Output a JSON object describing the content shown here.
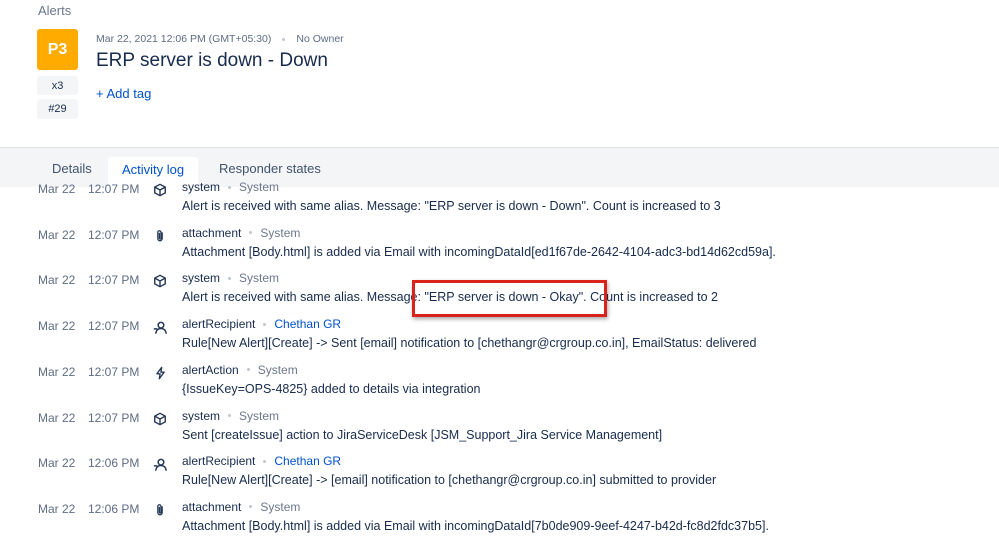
{
  "breadcrumb": "Alerts",
  "alert": {
    "priority": "P3",
    "count": "x3",
    "tiny_id": "#29",
    "timestamp": "Mar 22, 2021 12:06 PM (GMT+05:30)",
    "owner": "No Owner",
    "title": "ERP server is down - Down",
    "add_tag_label": "+ Add tag"
  },
  "tabs": [
    {
      "label": "Details",
      "active": false
    },
    {
      "label": "Activity log",
      "active": true
    },
    {
      "label": "Responder states",
      "active": false
    }
  ],
  "activity_log": [
    {
      "date": "Mar 22",
      "time": "12:07 PM",
      "icon": "cube-icon",
      "source": "system",
      "actor": "System",
      "actor_link": false,
      "message": "Alert is received with same alias. Message: \"ERP server is down - Down\". Count is increased to 3"
    },
    {
      "date": "Mar 22",
      "time": "12:07 PM",
      "icon": "paperclip-icon",
      "source": "attachment",
      "actor": "System",
      "actor_link": false,
      "message": "Attachment [Body.html] is added via Email with incomingDataId[ed1f67de-2642-4104-adc3-bd14d62cd59a]."
    },
    {
      "date": "Mar 22",
      "time": "12:07 PM",
      "icon": "cube-icon",
      "source": "system",
      "actor": "System",
      "actor_link": false,
      "message": "Alert is received with same alias. Message: \"ERP server is down - Okay\". Count is increased to 2"
    },
    {
      "date": "Mar 22",
      "time": "12:07 PM",
      "icon": "recipient-icon",
      "source": "alertRecipient",
      "actor": "Chethan GR",
      "actor_link": true,
      "message": "Rule[New Alert][Create] -> Sent [email] notification to [chethangr@crgroup.co.in], EmailStatus: delivered"
    },
    {
      "date": "Mar 22",
      "time": "12:07 PM",
      "icon": "bolt-icon",
      "source": "alertAction",
      "actor": "System",
      "actor_link": false,
      "message": "{IssueKey=OPS-4825} added to details via integration"
    },
    {
      "date": "Mar 22",
      "time": "12:07 PM",
      "icon": "cube-icon",
      "source": "system",
      "actor": "System",
      "actor_link": false,
      "message": "Sent [createIssue] action to JiraServiceDesk [JSM_Support_Jira Service Management]"
    },
    {
      "date": "Mar 22",
      "time": "12:06 PM",
      "icon": "recipient-icon",
      "source": "alertRecipient",
      "actor": "Chethan GR",
      "actor_link": true,
      "message": "Rule[New Alert][Create] -> [email] notification to [chethangr@crgroup.co.in] submitted to provider"
    },
    {
      "date": "Mar 22",
      "time": "12:06 PM",
      "icon": "paperclip-icon",
      "source": "attachment",
      "actor": "System",
      "actor_link": false,
      "message": "Attachment [Body.html] is added via Email with incomingDataId[7b0de909-9eef-4247-b42d-fc8d2fdc37b5]."
    }
  ],
  "colors": {
    "priority_badge": "#ffab00",
    "link": "#0052cc",
    "highlight_box": "#d9241c"
  }
}
